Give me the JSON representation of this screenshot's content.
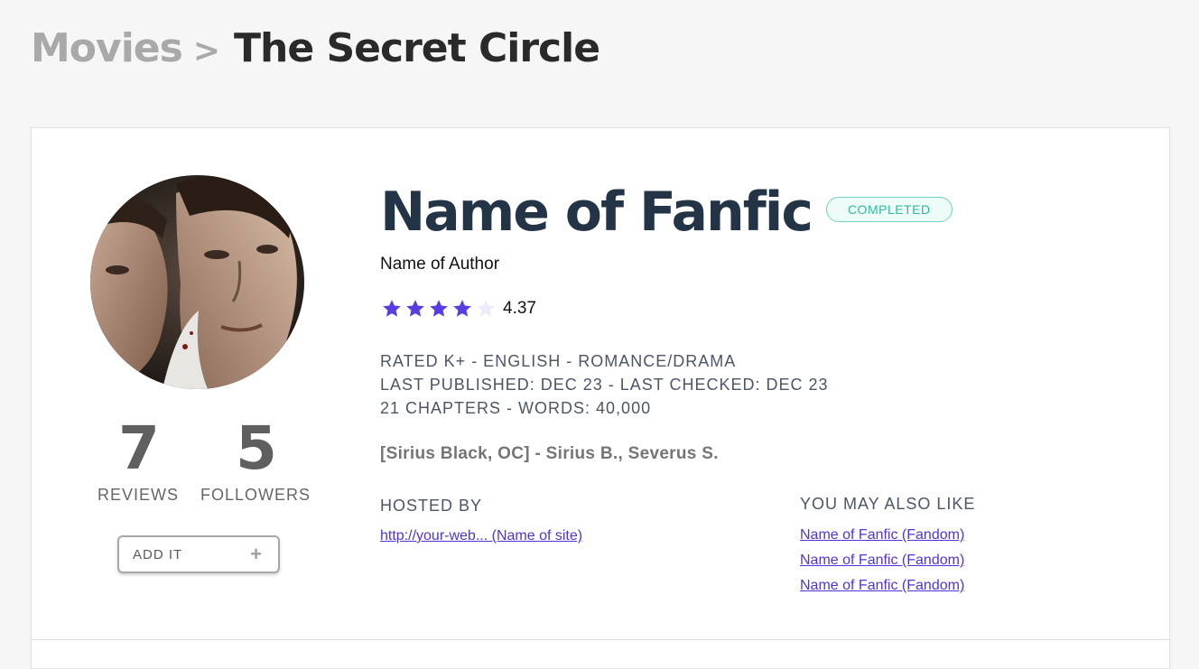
{
  "breadcrumb": {
    "parent": "Movies",
    "separator": ">",
    "current": "The Secret Circle"
  },
  "fic": {
    "title": "Name of Fanfic",
    "status": "COMPLETED",
    "author": "Name of Author",
    "rating_value": "4.37",
    "stars_filled": 4,
    "stars_total": 5,
    "meta_lines": [
      "RATED K+ - ENGLISH - ROMANCE/DRAMA",
      "LAST PUBLISHED: DEC 23 - LAST CHECKED: DEC 23",
      "21 CHAPTERS - WORDS: 40,000"
    ],
    "characters": "[Sirius Black, OC] - Sirius B., Severus S."
  },
  "stats": {
    "reviews_count": "7",
    "reviews_label": "REVIEWS",
    "followers_count": "5",
    "followers_label": "FOLLOWERS"
  },
  "add_button": {
    "label": "ADD IT",
    "icon": "plus-icon"
  },
  "hosted": {
    "heading": "HOSTED BY",
    "link": "http://your-web... (Name of site)"
  },
  "also_like": {
    "heading": "YOU MAY ALSO LIKE",
    "items": [
      "Name of Fanfic (Fandom)",
      "Name of Fanfic (Fandom)",
      "Name of Fanfic (Fandom)"
    ]
  },
  "colors": {
    "accent": "#5233d9",
    "star_filled": "#5a3de2",
    "star_empty": "#ecebf8",
    "title": "#243447",
    "badge": "#2bbd9b"
  }
}
